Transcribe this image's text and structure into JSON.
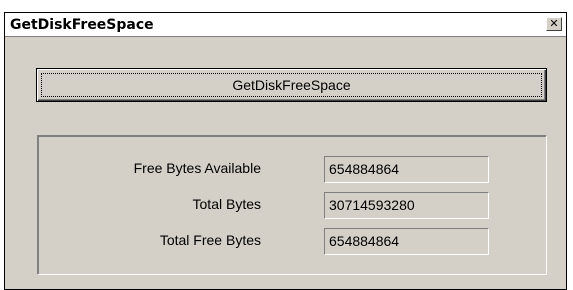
{
  "window": {
    "title": "GetDiskFreeSpace",
    "close_glyph": "✕"
  },
  "main_button": {
    "label": "GetDiskFreeSpace"
  },
  "results": {
    "rows": [
      {
        "label": "Free Bytes Available",
        "value": "654884864"
      },
      {
        "label": "Total Bytes",
        "value": "30714593280"
      },
      {
        "label": "Total Free Bytes",
        "value": "654884864"
      }
    ]
  },
  "colors": {
    "face": "#d4d0c8",
    "shadow": "#808080",
    "highlight": "#ffffff",
    "text": "#000000"
  }
}
